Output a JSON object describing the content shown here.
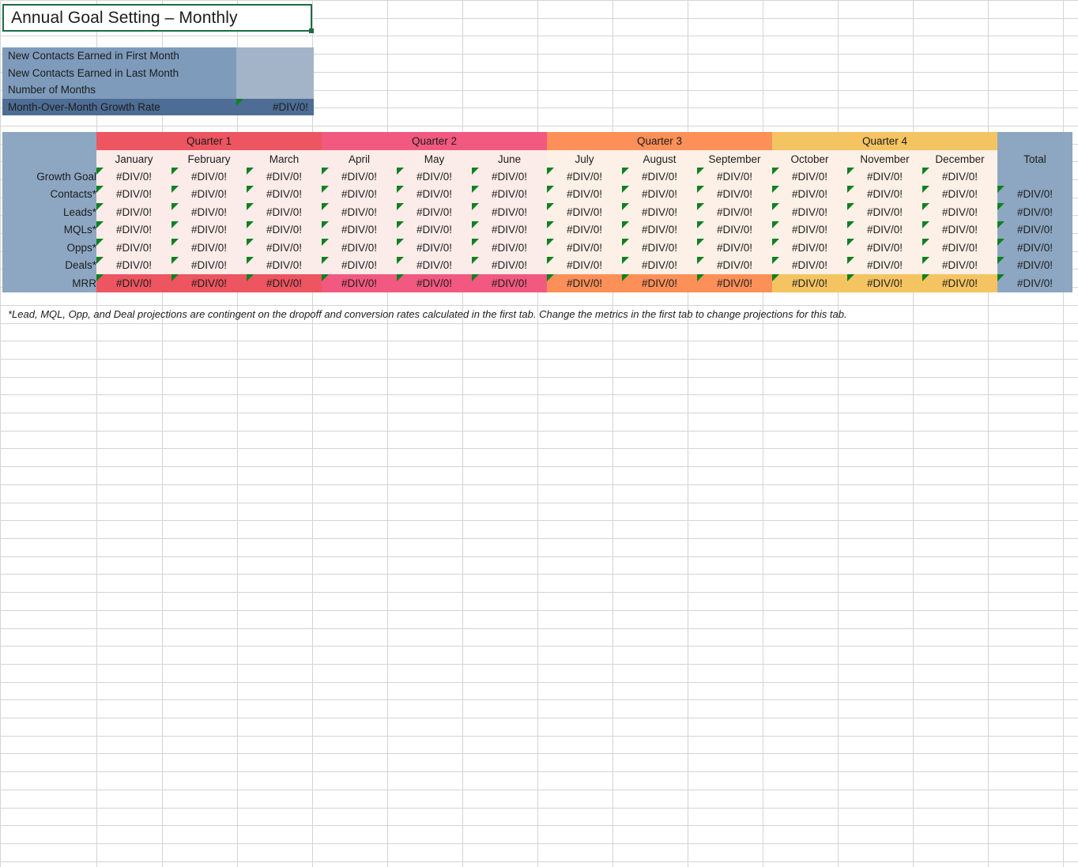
{
  "title": {
    "text": "Annual Goal Setting – Monthly"
  },
  "assumptions": {
    "rows": [
      {
        "label": "New Contacts Earned in First Month",
        "value": ""
      },
      {
        "label": "New Contacts Earned in Last Month",
        "value": ""
      },
      {
        "label": "Number of Months",
        "value": ""
      },
      {
        "label": "Month-Over-Month Growth Rate",
        "value": "#DIV/0!"
      }
    ]
  },
  "table": {
    "quarters": [
      {
        "label": "Quarter 1",
        "color": "#ed5560"
      },
      {
        "label": "Quarter 2",
        "color": "#f25980"
      },
      {
        "label": "Quarter 3",
        "color": "#fc9058"
      },
      {
        "label": "Quarter 4",
        "color": "#f5c462"
      }
    ],
    "months": [
      "January",
      "February",
      "March",
      "April",
      "May",
      "June",
      "July",
      "August",
      "September",
      "October",
      "November",
      "December"
    ],
    "total_header": "Total",
    "rows": [
      {
        "label": "Growth Goal",
        "values": [
          "#DIV/0!",
          "#DIV/0!",
          "#DIV/0!",
          "#DIV/0!",
          "#DIV/0!",
          "#DIV/0!",
          "#DIV/0!",
          "#DIV/0!",
          "#DIV/0!",
          "#DIV/0!",
          "#DIV/0!",
          "#DIV/0!"
        ],
        "total": ""
      },
      {
        "label": "Contacts*",
        "values": [
          "#DIV/0!",
          "#DIV/0!",
          "#DIV/0!",
          "#DIV/0!",
          "#DIV/0!",
          "#DIV/0!",
          "#DIV/0!",
          "#DIV/0!",
          "#DIV/0!",
          "#DIV/0!",
          "#DIV/0!",
          "#DIV/0!"
        ],
        "total": "#DIV/0!"
      },
      {
        "label": "Leads*",
        "values": [
          "#DIV/0!",
          "#DIV/0!",
          "#DIV/0!",
          "#DIV/0!",
          "#DIV/0!",
          "#DIV/0!",
          "#DIV/0!",
          "#DIV/0!",
          "#DIV/0!",
          "#DIV/0!",
          "#DIV/0!",
          "#DIV/0!"
        ],
        "total": "#DIV/0!"
      },
      {
        "label": "MQLs*",
        "values": [
          "#DIV/0!",
          "#DIV/0!",
          "#DIV/0!",
          "#DIV/0!",
          "#DIV/0!",
          "#DIV/0!",
          "#DIV/0!",
          "#DIV/0!",
          "#DIV/0!",
          "#DIV/0!",
          "#DIV/0!",
          "#DIV/0!"
        ],
        "total": "#DIV/0!"
      },
      {
        "label": "Opps*",
        "values": [
          "#DIV/0!",
          "#DIV/0!",
          "#DIV/0!",
          "#DIV/0!",
          "#DIV/0!",
          "#DIV/0!",
          "#DIV/0!",
          "#DIV/0!",
          "#DIV/0!",
          "#DIV/0!",
          "#DIV/0!",
          "#DIV/0!"
        ],
        "total": "#DIV/0!"
      },
      {
        "label": "Deals*",
        "values": [
          "#DIV/0!",
          "#DIV/0!",
          "#DIV/0!",
          "#DIV/0!",
          "#DIV/0!",
          "#DIV/0!",
          "#DIV/0!",
          "#DIV/0!",
          "#DIV/0!",
          "#DIV/0!",
          "#DIV/0!",
          "#DIV/0!"
        ],
        "total": "#DIV/0!"
      },
      {
        "label": "MRR",
        "values": [
          "#DIV/0!",
          "#DIV/0!",
          "#DIV/0!",
          "#DIV/0!",
          "#DIV/0!",
          "#DIV/0!",
          "#DIV/0!",
          "#DIV/0!",
          "#DIV/0!",
          "#DIV/0!",
          "#DIV/0!",
          "#DIV/0!"
        ],
        "total": "#DIV/0!"
      }
    ]
  },
  "footnote": {
    "text": "*Lead, MQL, Opp, and Deal projections are contingent on the dropoff and conversion rates calculated in the first tab. Change the metrics in the first tab to change projections for this tab."
  },
  "colors": {
    "selection_border": "#1d6b44",
    "comment_flag": "#0f8020",
    "panel_label": "#7e9bbc",
    "panel_value": "#a3b4c8",
    "panel_dark": "#4d6d94",
    "header_blue": "#8da7c2",
    "cell_pink": "#fcece9",
    "cell_cream": "#fdf0e6",
    "gridline": "#d4d4d4"
  }
}
